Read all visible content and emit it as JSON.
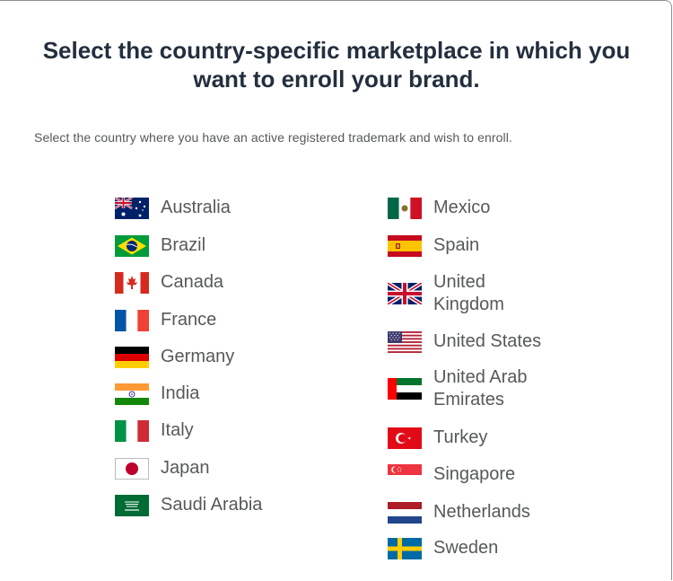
{
  "heading": "Select the country-specific marketplace in which you want to enroll your brand.",
  "subtitle": "Select the country where you have an active registered trademark and wish to enroll.",
  "countries": [
    {
      "label": "Australia",
      "flag_icon": "australia-flag-icon"
    },
    {
      "label": "Brazil",
      "flag_icon": "brazil-flag-icon"
    },
    {
      "label": "Canada",
      "flag_icon": "canada-flag-icon"
    },
    {
      "label": "France",
      "flag_icon": "france-flag-icon"
    },
    {
      "label": "Germany",
      "flag_icon": "germany-flag-icon"
    },
    {
      "label": "India",
      "flag_icon": "india-flag-icon"
    },
    {
      "label": "Italy",
      "flag_icon": "italy-flag-icon"
    },
    {
      "label": "Japan",
      "flag_icon": "japan-flag-icon"
    },
    {
      "label": "Saudi Arabia",
      "flag_icon": "saudi-arabia-flag-icon"
    },
    {
      "label": "Mexico",
      "flag_icon": "mexico-flag-icon"
    },
    {
      "label": "Spain",
      "flag_icon": "spain-flag-icon"
    },
    {
      "label": "United Kingdom",
      "flag_icon": "united-kingdom-flag-icon"
    },
    {
      "label": "United States",
      "flag_icon": "united-states-flag-icon"
    },
    {
      "label": "United Arab Emirates",
      "flag_icon": "uae-flag-icon"
    },
    {
      "label": "Turkey",
      "flag_icon": "turkey-flag-icon"
    },
    {
      "label": "Singapore",
      "flag_icon": "singapore-flag-icon"
    },
    {
      "label": "Netherlands",
      "flag_icon": "netherlands-flag-icon"
    },
    {
      "label": "Sweden",
      "flag_icon": "sweden-flag-icon"
    }
  ],
  "colors": {
    "heading": "#232f3e",
    "text": "#565959"
  }
}
